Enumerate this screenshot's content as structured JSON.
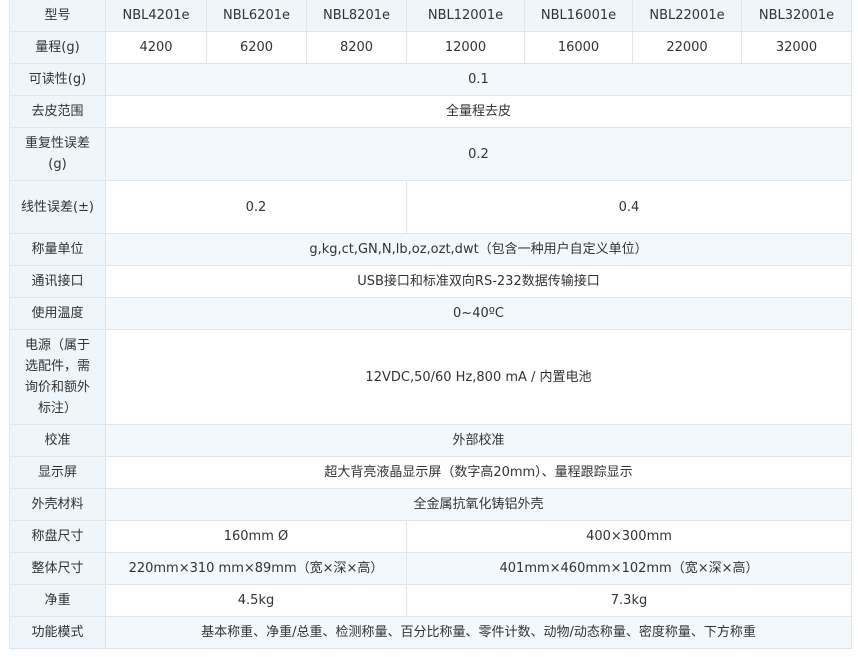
{
  "table": {
    "header_label": "型号",
    "models": [
      "NBL4201e",
      "NBL6201e",
      "NBL8201e",
      "NBL12001e",
      "NBL16001e",
      "NBL22001e",
      "NBL32001e"
    ],
    "capacity": {
      "label": "量程(g)",
      "values": [
        "4200",
        "6200",
        "8200",
        "12000",
        "16000",
        "22000",
        "32000"
      ]
    },
    "readability": {
      "label": "可读性(g)",
      "value": "0.1"
    },
    "tare_range": {
      "label": "去皮范围",
      "value": "全量程去皮"
    },
    "repeatability": {
      "label": "重复性误差(g)",
      "value": "0.2"
    },
    "linearity": {
      "label": "线性误差(±)",
      "value_a": "0.2",
      "value_b": "0.4"
    },
    "units": {
      "label": "称量单位",
      "value": "g,kg,ct,GN,N,lb,oz,ozt,dwt（包含一种用户自定义单位）"
    },
    "interface": {
      "label": "通讯接口",
      "value": "USB接口和标准双向RS-232数据传输接口"
    },
    "temperature": {
      "label": "使用温度",
      "value": "0~40ºC"
    },
    "power": {
      "label": "电源（属于选配件，需询价和额外标注）",
      "value": "12VDC,50/60 Hz,800 mA / 内置电池"
    },
    "calibration": {
      "label": "校准",
      "value": "外部校准"
    },
    "display": {
      "label": "显示屏",
      "value": "超大背亮液晶显示屏（数字高20mm）、量程跟踪显示"
    },
    "housing": {
      "label": "外壳材料",
      "value": "全金属抗氧化铸铝外壳"
    },
    "pan_size": {
      "label": "称盘尺寸",
      "value_a": "160mm Ø",
      "value_b": "400×300mm"
    },
    "dimensions": {
      "label": "整体尺寸",
      "value_a": "220mm×310 mm×89mm（宽×深×高）",
      "value_b": "401mm×460mm×102mm（宽×深×高）"
    },
    "net_weight": {
      "label": "净重",
      "value_a": "4.5kg",
      "value_b": "7.3kg"
    },
    "functions": {
      "label": "功能模式",
      "value": "基本称重、净重/总重、检测称量、百分比称量、零件计数、动物/动态称量、密度称量、下方称重"
    }
  }
}
